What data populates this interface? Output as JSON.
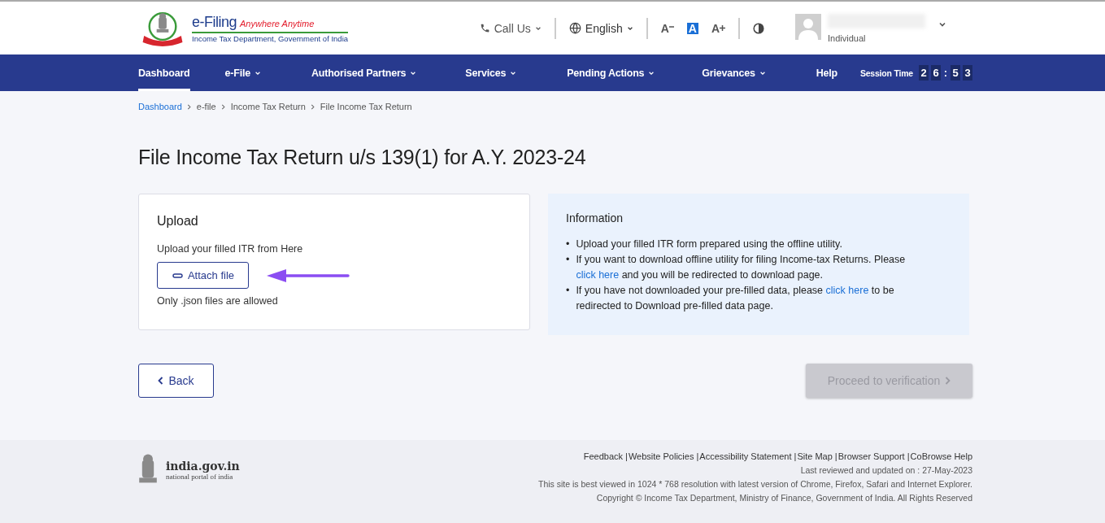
{
  "header": {
    "brand": {
      "name": "e-Filing",
      "tagline": "Anywhere Anytime",
      "department": "Income Tax Department, Government of India"
    },
    "call_us": "Call Us",
    "language": "English",
    "font_controls": [
      {
        "kind": "decrease",
        "label": "A",
        "selected": false
      },
      {
        "kind": "default",
        "label": "A",
        "selected": true
      },
      {
        "kind": "increase",
        "label": "A",
        "selected": false
      }
    ],
    "user": {
      "role": "Individual"
    }
  },
  "nav": {
    "items": [
      {
        "label": "Dashboard",
        "selected": true,
        "dropdown": false
      },
      {
        "label": "e-File",
        "selected": false,
        "dropdown": true
      },
      {
        "label": "Authorised Partners",
        "selected": false,
        "dropdown": true
      },
      {
        "label": "Services",
        "selected": false,
        "dropdown": true
      },
      {
        "label": "Pending Actions",
        "selected": false,
        "dropdown": true
      },
      {
        "label": "Grievances",
        "selected": false,
        "dropdown": true
      },
      {
        "label": "Help",
        "selected": false,
        "dropdown": false
      }
    ],
    "session": {
      "label": "Session Time",
      "parts": [
        {
          "kind": "digit",
          "text": "2"
        },
        {
          "kind": "digit",
          "text": "6"
        },
        {
          "kind": "separator",
          "text": ":"
        },
        {
          "kind": "digit",
          "text": "5"
        },
        {
          "kind": "digit",
          "text": "3"
        }
      ]
    }
  },
  "breadcrumb": [
    {
      "label": "Dashboard",
      "link": true
    },
    {
      "label": "e-file",
      "link": false
    },
    {
      "label": "Income Tax Return",
      "link": false
    },
    {
      "label": "File Income Tax Return",
      "link": false
    }
  ],
  "title": "File Income Tax Return u/s 139(1) for A.Y. 2023-24",
  "upload": {
    "heading": "Upload",
    "prompt": "Upload your filled ITR from Here",
    "button": "Attach file",
    "note": "Only .json files are allowed"
  },
  "information": {
    "heading": "Information",
    "marker": "•",
    "items": [
      [
        {
          "kind": "text",
          "text": "Upload your filled ITR form prepared using the offline utility."
        }
      ],
      [
        {
          "kind": "text",
          "text": "If you want to download offline utility for filing Income-tax Returns. Please "
        },
        {
          "kind": "link",
          "text": "click here"
        },
        {
          "kind": "text",
          "text": " and you will be redirected to download page."
        }
      ],
      [
        {
          "kind": "text",
          "text": "If you have not downloaded your pre-filled data, please "
        },
        {
          "kind": "link",
          "text": "click here"
        },
        {
          "kind": "text",
          "text": " to be redirected to Download pre-filled data page."
        }
      ]
    ]
  },
  "actions": {
    "back": {
      "label": "Back"
    },
    "proceed": {
      "label": "Proceed to verification",
      "disabled": true
    }
  },
  "footer": {
    "portal": {
      "name": "india.gov.in",
      "tagline": "national portal of india"
    },
    "separator": " |",
    "links": [
      "Feedback",
      "Website Policies",
      "Accessibility Statement",
      "Site Map",
      "Browser Support",
      "CoBrowse Help"
    ],
    "lines": [
      "Last reviewed and updated on : 27-May-2023",
      "This site is best viewed in 1024 * 768 resolution with latest version of Chrome, Firefox, Safari and Internet Explorer.",
      "Copyright © Income Tax Department, Ministry of Finance, Government of India. All Rights Reserved"
    ]
  }
}
